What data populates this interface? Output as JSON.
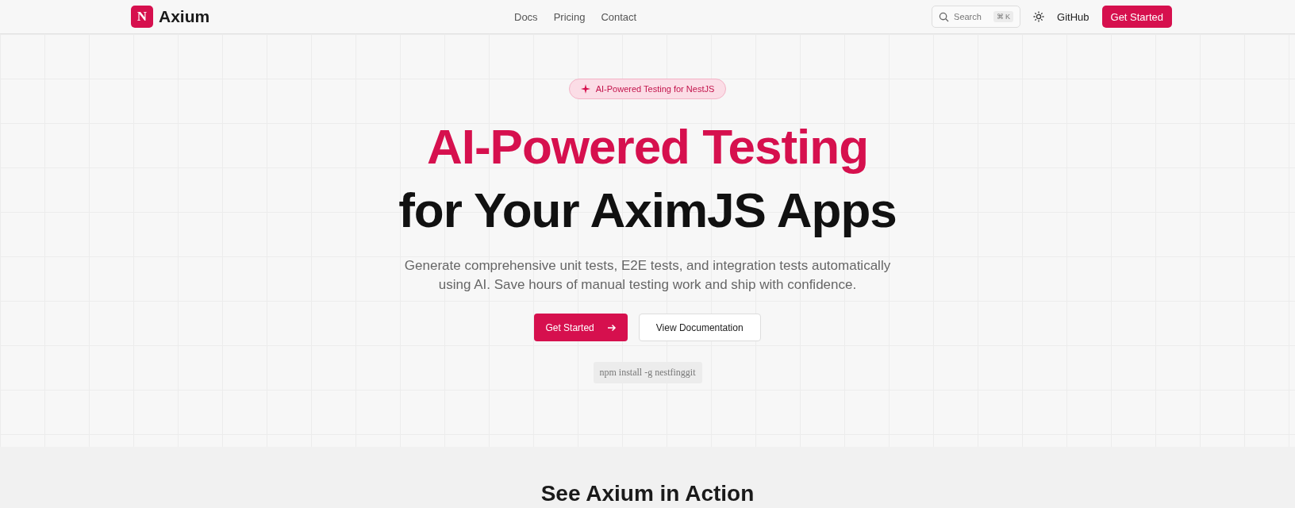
{
  "header": {
    "logo_letter": "N",
    "brand": "Axium",
    "nav_links": [
      {
        "label": "Docs"
      },
      {
        "label": "Pricing"
      },
      {
        "label": "Contact"
      }
    ],
    "search": {
      "placeholder": "Search",
      "shortcut": "⌘ K"
    },
    "github_link": "GitHub",
    "cta": "Get Started"
  },
  "hero": {
    "badge": "AI-Powered Testing for NestJS",
    "title_line_1": "AI-Powered Testing",
    "title_line_2": "for Your AximJS Apps",
    "description": "Generate comprehensive unit tests, E2E tests, and integration tests automatically using AI. Save hours of manual testing work and ship with confidence.",
    "primary_button": "Get Started",
    "secondary_button": "View Documentation",
    "install_command": "npm install -g nestfinggit"
  },
  "next_section": {
    "heading": "See Axium in Action"
  }
}
